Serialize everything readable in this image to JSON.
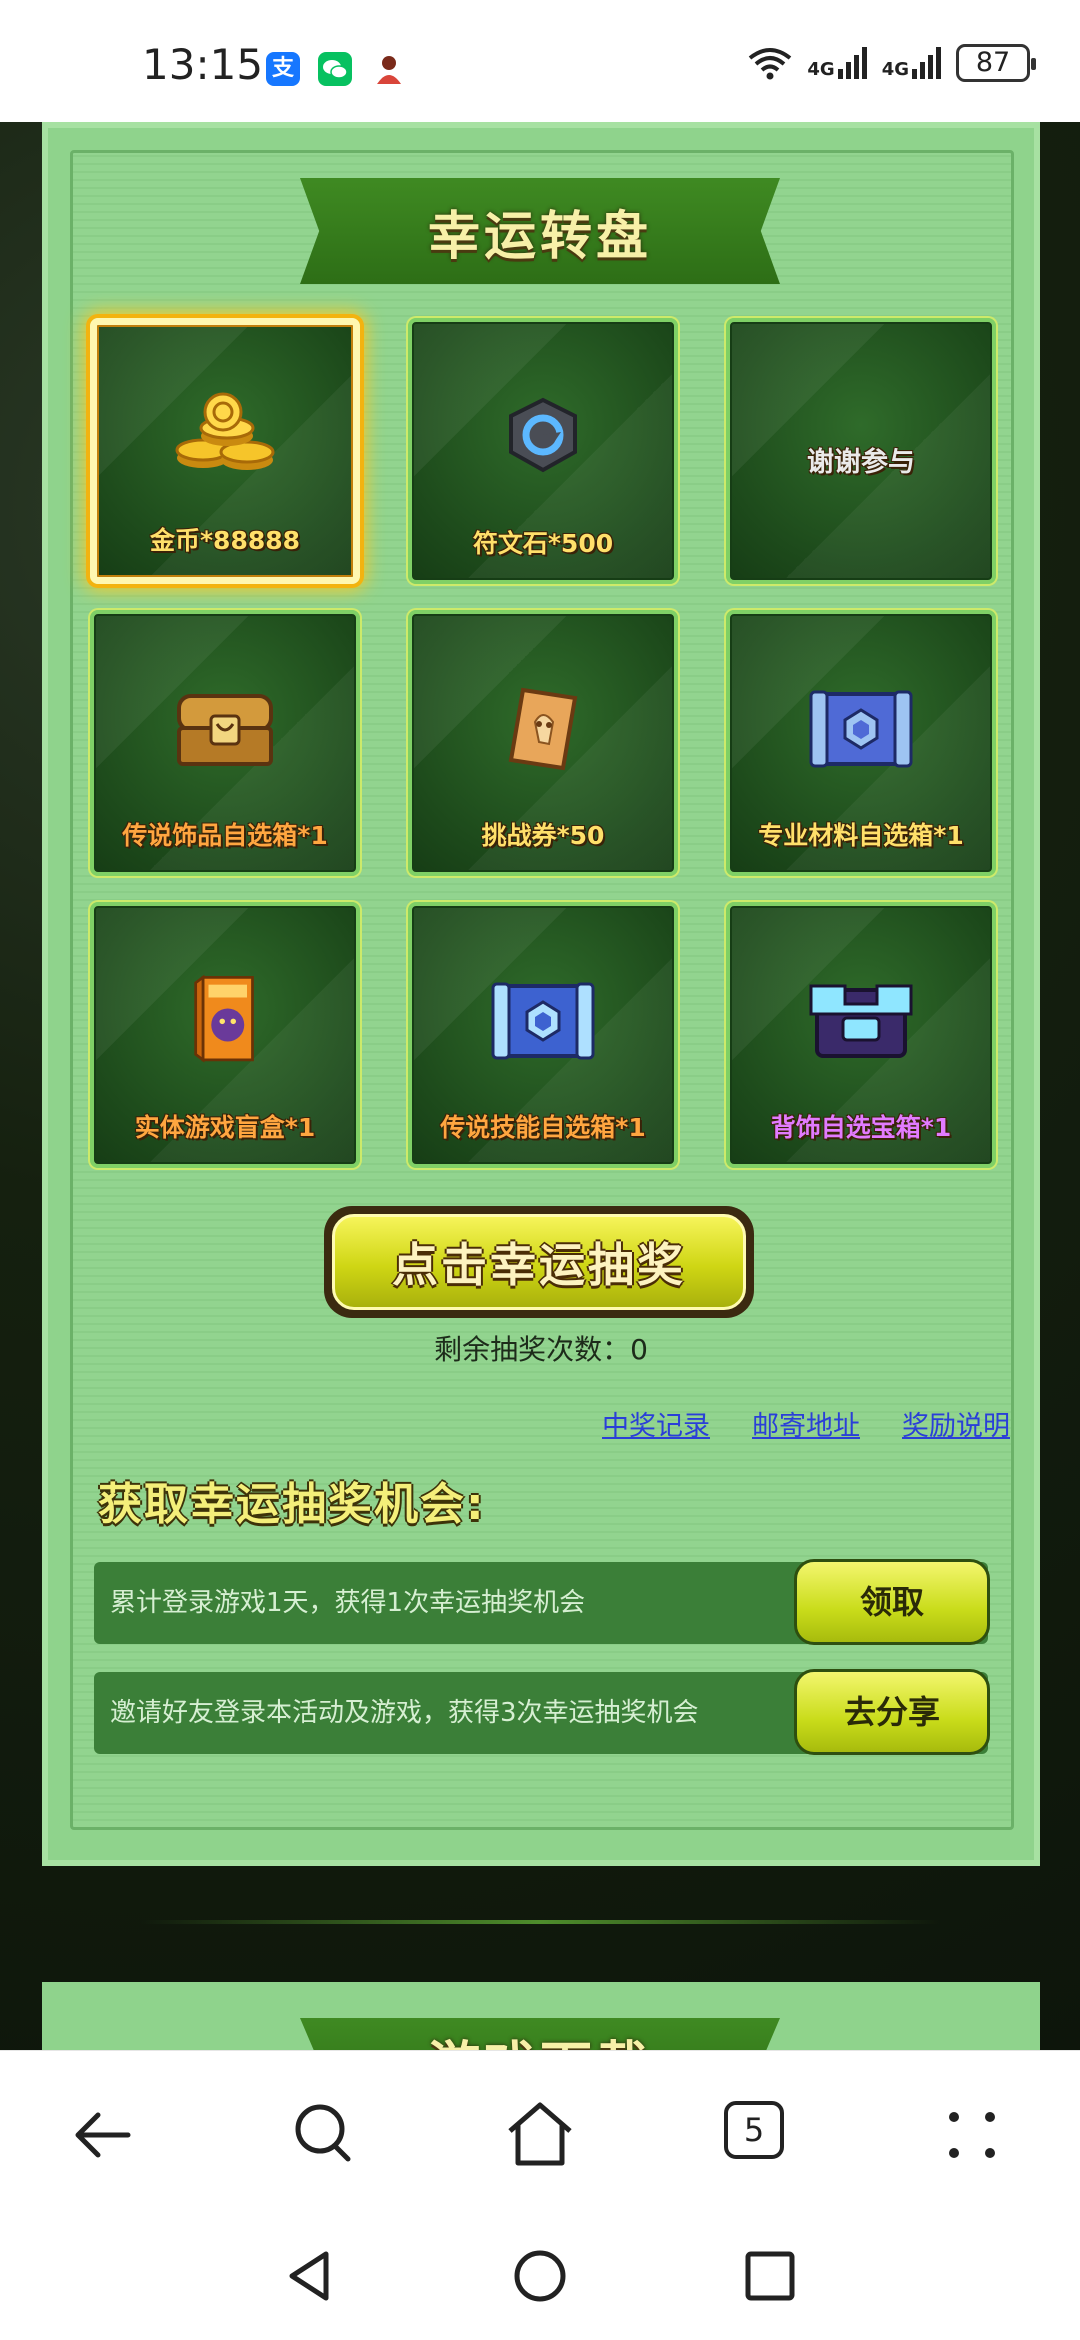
{
  "status_bar": {
    "time": "13:15",
    "apps": [
      {
        "name": "alipay-icon",
        "glyph": "支",
        "color": "#1677ff"
      },
      {
        "name": "wechat-icon",
        "glyph": "",
        "color": "#07c160"
      },
      {
        "name": "app-avatar-icon",
        "glyph": "",
        "color": "#d9453a"
      }
    ],
    "signal_labels": [
      "4G",
      "4G"
    ],
    "battery": "87"
  },
  "lottery": {
    "title": "幸运转盘",
    "prizes": [
      {
        "label": "金币*88888",
        "icon": "gold-coins-icon",
        "style": "yellow",
        "active": true
      },
      {
        "label": "符文石*500",
        "icon": "rune-stone-icon",
        "style": "yellow"
      },
      {
        "label": "谢谢参与",
        "icon": "",
        "style": "center"
      },
      {
        "label": "传说饰品自选箱*1",
        "icon": "legend-accessory-chest-icon",
        "style": "orange"
      },
      {
        "label": "挑战券*50",
        "icon": "challenge-ticket-icon",
        "style": "yellow"
      },
      {
        "label": "专业材料自选箱*1",
        "icon": "material-chest-icon",
        "style": "yellow"
      },
      {
        "label": "实体游戏盲盒*1",
        "icon": "blind-box-icon",
        "style": "orange"
      },
      {
        "label": "传说技能自选箱*1",
        "icon": "skill-chest-icon",
        "style": "orange"
      },
      {
        "label": "背饰自选宝箱*1",
        "icon": "back-accessory-chest-icon",
        "style": "purple"
      }
    ],
    "draw_button": "点击幸运抽奖",
    "remaining": "剩余抽奖次数：0",
    "links": [
      "中奖记录",
      "邮寄地址",
      "奖励说明"
    ],
    "chance_title": "获取幸运抽奖机会:",
    "tasks": [
      {
        "text": "累计登录游戏1天，获得1次幸运抽奖机会",
        "button": "领取"
      },
      {
        "text": "邀请好友登录本活动及游戏，获得3次幸运抽奖机会",
        "button": "去分享"
      }
    ]
  },
  "next_section": {
    "title": "游戏下载"
  },
  "browser_toolbar": {
    "tab_count": "5",
    "icons": [
      "back-arrow-icon",
      "search-icon",
      "home-icon",
      "tabs-icon",
      "more-icon"
    ]
  },
  "system_nav": {
    "icons": [
      "nav-back-icon",
      "nav-home-icon",
      "nav-recents-icon"
    ]
  }
}
